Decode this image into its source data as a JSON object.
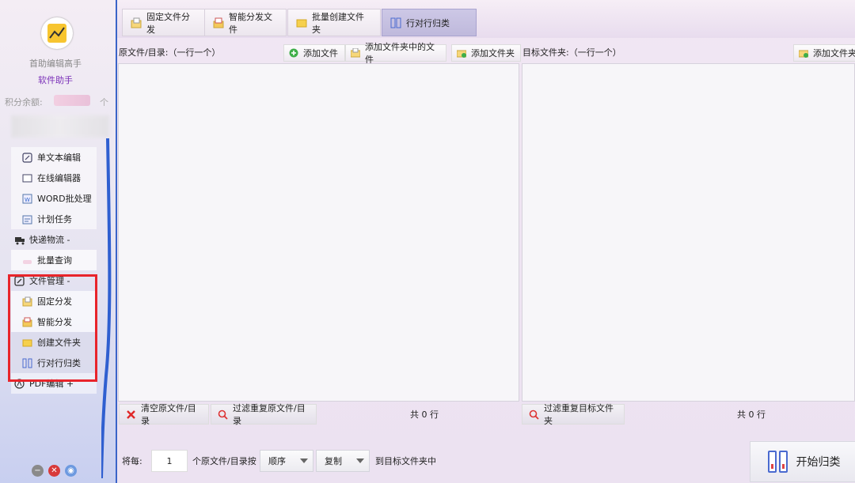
{
  "sidebar": {
    "app_name": "首助编辑高手",
    "app_sub": "软件助手",
    "credit_label": "积分余额:",
    "credit_unit": "个",
    "items": [
      {
        "label": "单文本编辑"
      },
      {
        "label": "在线编辑器"
      },
      {
        "label": "WORD批处理"
      },
      {
        "label": "计划任务"
      },
      {
        "label": "快递物流 -"
      },
      {
        "label": "批量查询"
      },
      {
        "label": "文件管理 -"
      },
      {
        "label": "固定分发"
      },
      {
        "label": "智能分发"
      },
      {
        "label": "创建文件夹"
      },
      {
        "label": "行对行归类"
      },
      {
        "label": "PDF编辑 +"
      }
    ],
    "window_buttons": [
      "−",
      "✕",
      "◉"
    ]
  },
  "toolbar": {
    "tabs": [
      {
        "label": "固定文件分发"
      },
      {
        "label": "智能分发文件"
      },
      {
        "label": "批量创建文件夹"
      },
      {
        "label": "行对行归类"
      }
    ]
  },
  "source": {
    "header": "原文件/目录:（一行一个）",
    "add_file": "添加文件",
    "add_folder_files": "添加文件夹中的文件",
    "add_folder": "添加文件夹",
    "clear": "清空原文件/目录",
    "filter": "过滤重复原文件/目录",
    "count": "共 0 行"
  },
  "target": {
    "header": "目标文件夹:（一行一个）",
    "add_folder": "添加文件夹",
    "filter": "过滤重复目标文件夹",
    "count": "共 0 行"
  },
  "bottom": {
    "prefix": "将每:",
    "quantity": "1",
    "middle": "个原文件/目录按",
    "order_value": "顺序",
    "mode_value": "复制",
    "suffix": "到目标文件夹中",
    "start": "开始归类"
  },
  "colors": {
    "accent_blue": "#3a64c8",
    "highlight_red": "#e8242b",
    "brand_purple": "#7a2fb8"
  }
}
